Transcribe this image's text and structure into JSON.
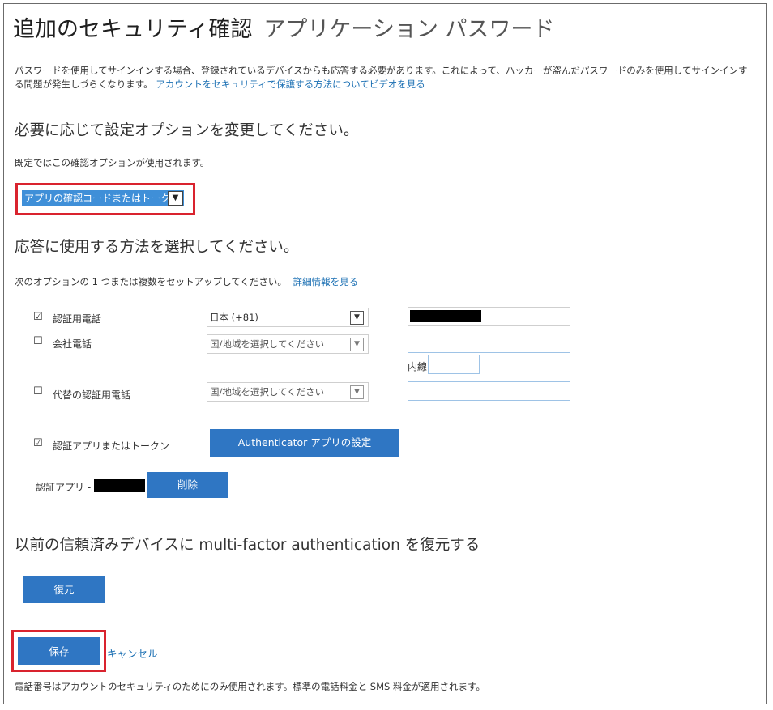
{
  "header": {
    "title": "追加のセキュリティ確認",
    "subtitle": "アプリケーション パスワード"
  },
  "intro": {
    "text": "パスワードを使用してサインインする場合、登録されているデバイスからも応答する必要があります。これによって、ハッカーが盗んだパスワードのみを使用してサインインする問題が発生しづらくなります。",
    "link": "アカウントをセキュリティで保護する方法についてビデオを見る"
  },
  "options_section": {
    "heading": "必要に応じて設定オプションを変更してください。",
    "default_note": "既定ではこの確認オプションが使用されます。",
    "selected_option": "アプリの確認コードまたはトークン"
  },
  "methods_section": {
    "heading": "応答に使用する方法を選択してください。",
    "instruction": "次のオプションの 1 つまたは複数をセットアップしてください。",
    "learn_more": "詳細情報を見る",
    "auth_phone": {
      "checked": "☑",
      "label": "認証用電話",
      "country": "日本 (+81)"
    },
    "office_phone": {
      "checked": "☐",
      "label": "会社電話",
      "country": "国/地域を選択してください",
      "extension_label": "内線"
    },
    "alt_phone": {
      "checked": "☐",
      "label": "代替の認証用電話",
      "country": "国/地域を選択してください"
    },
    "auth_app": {
      "checked": "☑",
      "label": "認証アプリまたはトークン",
      "setup_button": "Authenticator アプリの設定"
    },
    "app_entry": {
      "label": "認証アプリ -",
      "delete_button": "削除"
    }
  },
  "restore_section": {
    "heading": "以前の信頼済みデバイスに multi-factor authentication を復元する",
    "button": "復元"
  },
  "actions": {
    "save": "保存",
    "cancel": "キャンセル"
  },
  "footer": {
    "note": "電話番号はアカウントのセキュリティのためにのみ使用されます。標準の電話料金と SMS 料金が適用されます。"
  },
  "icons": {
    "dropdown": "chevron-down-icon",
    "checkbox": "checkbox-icon"
  },
  "colors": {
    "accent": "#2f76c3",
    "link": "#1a6fb3",
    "highlight": "#d9232e"
  }
}
